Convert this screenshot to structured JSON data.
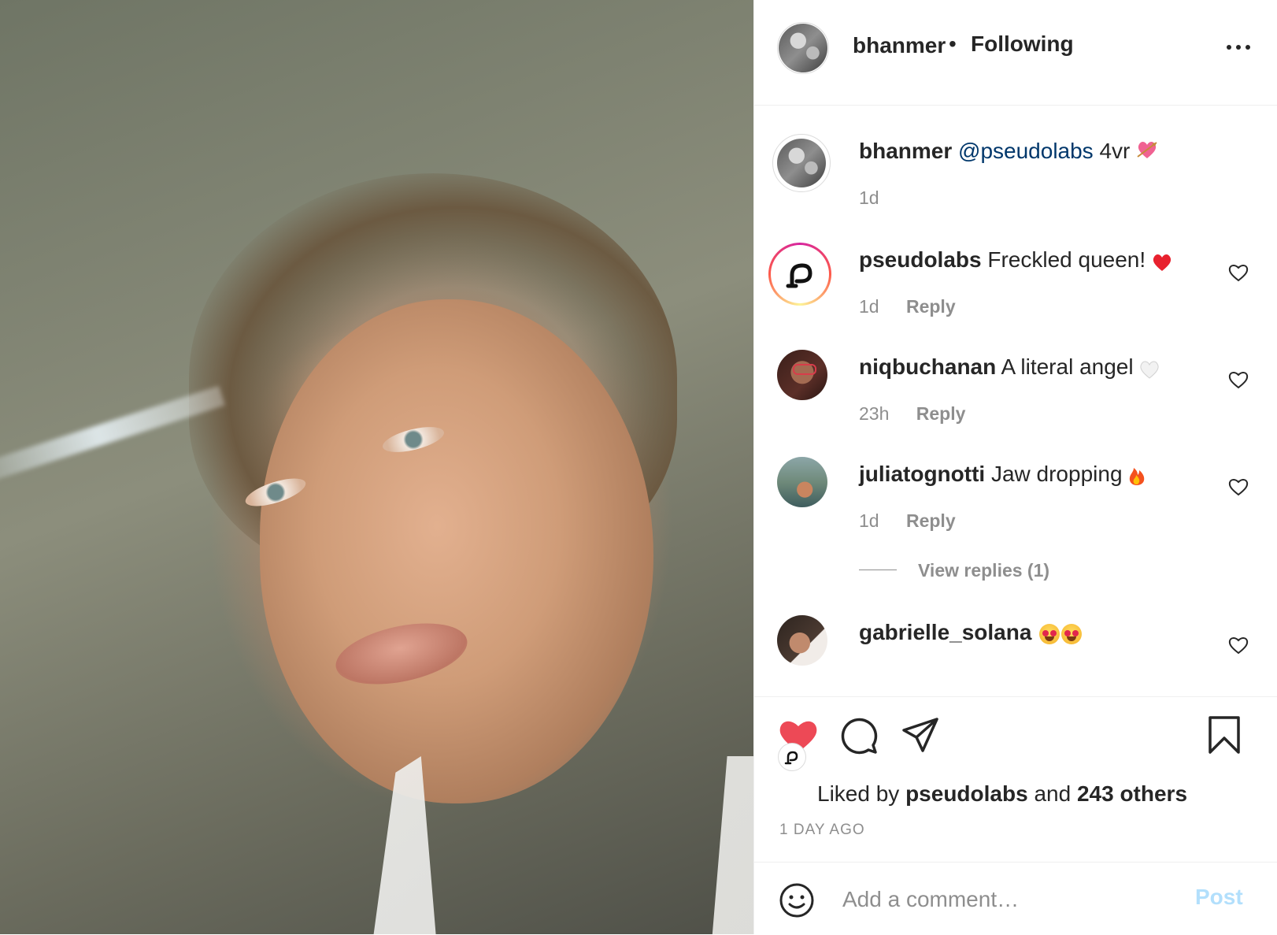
{
  "post": {
    "photo_description_icon": "selfie-photo",
    "author": "bhanmer",
    "separator": "•",
    "follow_status": "Following",
    "caption": {
      "user": "bhanmer",
      "mention": "@pseudolabs",
      "text": " 4vr ",
      "emoji": "heart-with-arrow",
      "time": "1d"
    }
  },
  "comments": [
    {
      "user": "pseudolabs",
      "text": " Freckled queen! ",
      "emoji": "red-heart",
      "time": "1d",
      "reply_label": "Reply"
    },
    {
      "user": "niqbuchanan",
      "text": " A literal angel ",
      "emoji": "white-heart",
      "time": "23h",
      "reply_label": "Reply"
    },
    {
      "user": "juliatognotti",
      "text": " Jaw dropping ",
      "emoji": "fire",
      "time": "1d",
      "reply_label": "Reply",
      "view_replies": "View replies (1)"
    },
    {
      "user": "gabrielle_solana",
      "text": " ",
      "emoji": "heart-eyes x2"
    }
  ],
  "actions": {
    "liked_prefix": "Liked by ",
    "liked_user": "pseudolabs",
    "liked_mid": " and ",
    "liked_count": "243 others",
    "timestamp": "1 DAY AGO",
    "liked": true
  },
  "add_comment": {
    "placeholder": "Add a comment…",
    "post_label": "Post"
  },
  "colors": {
    "like_red": "#ed4956",
    "mention_blue": "#00376b",
    "post_disabled": "#b2dffc",
    "secondary_text": "#8e8e8e"
  }
}
